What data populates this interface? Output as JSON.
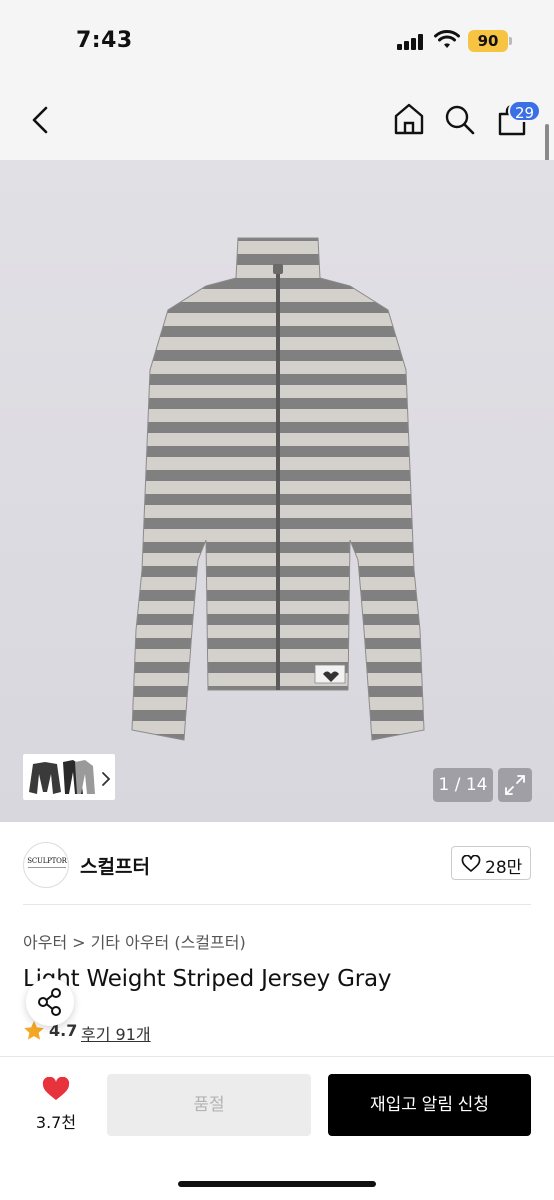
{
  "status": {
    "time": "7:43",
    "battery": "90"
  },
  "nav": {
    "cart_count": "29"
  },
  "hero": {
    "page_counter": "1 / 14"
  },
  "brand": {
    "logo_text": "SCULPTOR",
    "name": "스컬프터",
    "like_count": "28만"
  },
  "breadcrumb": {
    "first": "아우터",
    "separator": ">",
    "second": "기타 아우터 (스컬프터)"
  },
  "product": {
    "title": "Light Weight Striped Jersey Gray",
    "rating": "4.7",
    "review_text": "후기 91개"
  },
  "bottom": {
    "wish_count": "3.7천",
    "soldout_label": "품절",
    "restock_label": "재입고 알림 신청"
  },
  "colors": {
    "accent_blue": "#3b6fe6",
    "battery_yellow": "#f6c343",
    "heart_red": "#e8333c",
    "star_orange": "#f5a623"
  }
}
